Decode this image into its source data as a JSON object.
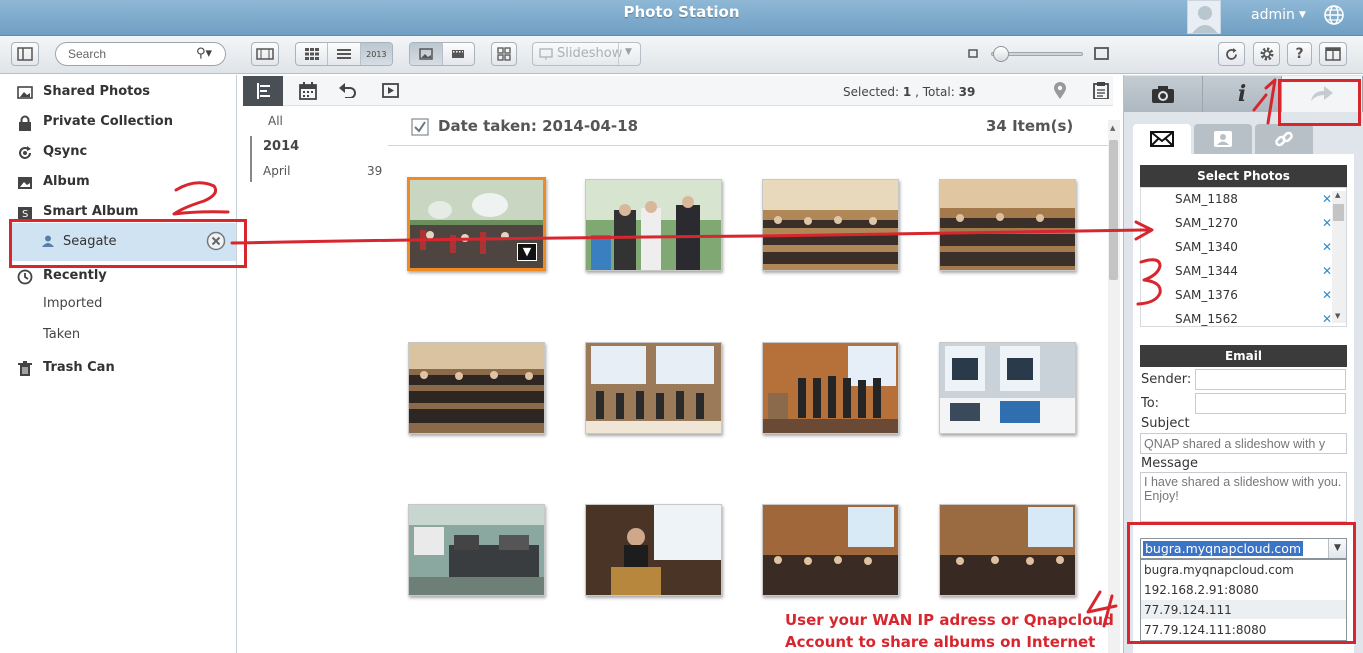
{
  "app": {
    "title": "Photo Station",
    "user": "admin"
  },
  "toolbar": {
    "search_placeholder": "Search",
    "slideshow_label": "Slideshow",
    "view_badge": "2013"
  },
  "sidebar": {
    "items": [
      {
        "label": "Shared Photos",
        "icon": "shared-photos-icon"
      },
      {
        "label": "Private Collection",
        "icon": "lock-icon"
      },
      {
        "label": "Qsync",
        "icon": "qsync-icon"
      },
      {
        "label": "Album",
        "icon": "album-icon"
      },
      {
        "label": "Smart Album",
        "icon": "smart-album-icon"
      }
    ],
    "smart_album_child": "Seagate",
    "recently": {
      "label": "Recently",
      "children": [
        "Imported",
        "Taken"
      ]
    },
    "trash": "Trash Can"
  },
  "timeline": {
    "all": "All",
    "year": "2014",
    "month": "April",
    "month_count": "39"
  },
  "content": {
    "selected_label": "Selected:",
    "selected_count": "1",
    "total_label": ", Total:",
    "total_count": "39",
    "date_header": "Date taken: 2014-04-18",
    "item_count": "34 Item(s)"
  },
  "share_panel": {
    "select_photos_title": "Select Photos",
    "photos": [
      "SAM_1188",
      "SAM_1270",
      "SAM_1340",
      "SAM_1344",
      "SAM_1376",
      "SAM_1562"
    ],
    "email_title": "Email",
    "sender_label": "Sender:",
    "to_label": "To:",
    "subject_label": "Subject",
    "subject_value": "QNAP shared a slideshow with y",
    "message_label": "Message",
    "message_value": "I have shared a slideshow with you. Enjoy!",
    "url_selected": "bugra.myqnapcloud.com",
    "url_options": [
      "bugra.myqnapcloud.com",
      "192.168.2.91:8080",
      "77.79.124.111",
      "77.79.124.111:8080"
    ]
  },
  "annotations": {
    "text_line1": "User your WAN IP adress or Qnapcloud",
    "text_line2": "Account to share albums on Internet",
    "color": "#d8262f"
  }
}
